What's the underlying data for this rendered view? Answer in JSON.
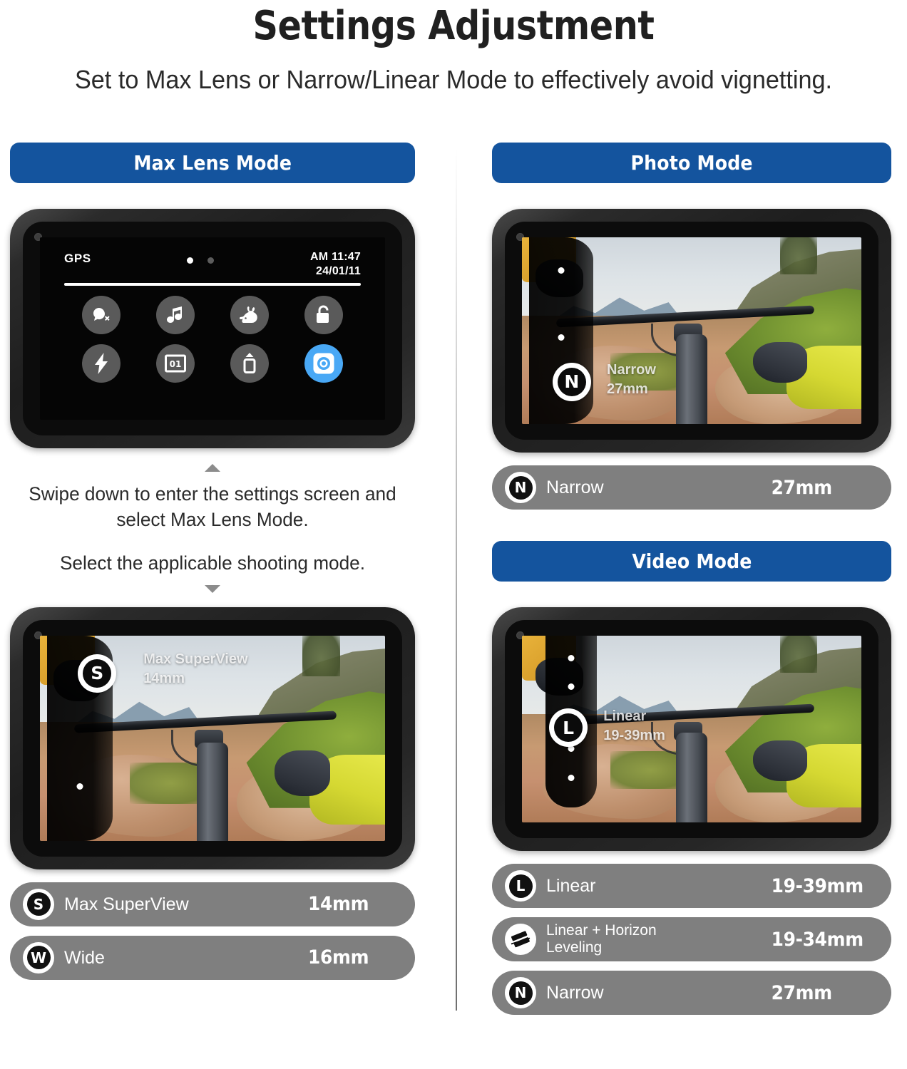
{
  "header": {
    "title": "Settings Adjustment",
    "subtitle": "Set to Max Lens or Narrow/Linear Mode to effectively avoid vignetting."
  },
  "colors": {
    "banner_blue": "#14549E",
    "pill_gray": "#7f7f7f",
    "active_tile_blue": "#49A8F5"
  },
  "left_column": {
    "banner": "Max Lens Mode",
    "settings_screen": {
      "gps_label": "GPS",
      "time": "AM 11:47",
      "date": "24/01/11",
      "page_dots": 2,
      "active_dot_index": 0,
      "tiles": [
        {
          "name": "voice-control-off-icon",
          "active": false
        },
        {
          "name": "beeps-music-note-icon",
          "active": false
        },
        {
          "name": "quick-capture-rabbit-icon",
          "active": false
        },
        {
          "name": "screen-lock-unlocked-icon",
          "active": false
        },
        {
          "name": "front-screen-flash-icon",
          "active": false
        },
        {
          "name": "screen-saver-01-icon",
          "active": false
        },
        {
          "name": "eject-sd-card-icon",
          "active": false
        },
        {
          "name": "max-lens-mode-icon",
          "active": true
        }
      ]
    },
    "instruction_1": "Swipe down to enter the settings screen\nand select Max Lens Mode.",
    "instruction_2": "Select the applicable shooting mode.",
    "preview": {
      "badge_letter": "S",
      "overlay_text": "Max SuperView\n14mm"
    },
    "pills": [
      {
        "letter": "S",
        "icon": "letter",
        "name": "Max SuperView",
        "value": "14mm"
      },
      {
        "letter": "W",
        "icon": "letter",
        "name": "Wide",
        "value": "16mm"
      }
    ]
  },
  "right_column": {
    "photo": {
      "banner": "Photo Mode",
      "preview": {
        "badge_letter": "N",
        "overlay_text": "Narrow\n27mm"
      },
      "pills": [
        {
          "letter": "N",
          "icon": "letter",
          "name": "Narrow",
          "value": "27mm"
        }
      ]
    },
    "video": {
      "banner": "Video Mode",
      "preview": {
        "badge_letter": "L",
        "overlay_text": "Linear\n19-39mm"
      },
      "pills": [
        {
          "letter": "L",
          "icon": "letter",
          "name": "Linear",
          "value": "19-39mm"
        },
        {
          "letter": "",
          "icon": "horizon-leveling-icon",
          "name": "Linear + Horizon\nLeveling",
          "value": "19-34mm"
        },
        {
          "letter": "N",
          "icon": "letter",
          "name": "Narrow",
          "value": "27mm"
        }
      ]
    }
  }
}
